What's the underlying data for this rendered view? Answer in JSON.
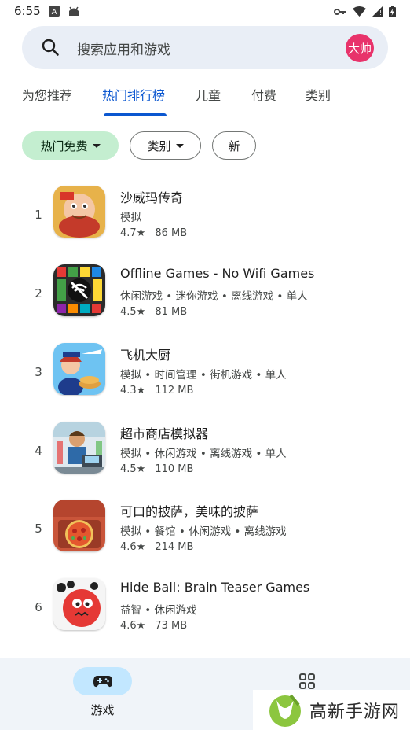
{
  "status_bar": {
    "time": "6:55",
    "left_icons": [
      "font-a-icon",
      "android-icon"
    ],
    "right_icons": [
      "key-icon",
      "wifi-icon",
      "signal-icon",
      "battery-charging-icon"
    ]
  },
  "search": {
    "placeholder": "搜索应用和游戏",
    "avatar_text": "大帅",
    "avatar_color": "#e8336b"
  },
  "tabs": [
    {
      "label": "为您推荐",
      "active": false
    },
    {
      "label": "热门排行榜",
      "active": true
    },
    {
      "label": "儿童",
      "active": false
    },
    {
      "label": "付费",
      "active": false
    },
    {
      "label": "类别",
      "active": false
    }
  ],
  "chips": [
    {
      "label": "热门免费",
      "selected": true,
      "dropdown": true
    },
    {
      "label": "类别",
      "selected": false,
      "dropdown": true
    },
    {
      "label": "新",
      "selected": false,
      "dropdown": false
    }
  ],
  "apps": [
    {
      "rank": "1",
      "name": "沙威玛传奇",
      "categories": "模拟",
      "rating": "4.7★",
      "size": "86 MB"
    },
    {
      "rank": "2",
      "name": "Offline Games - No Wifi Games",
      "categories": "休闲游戏 • 迷你游戏 • 离线游戏 • 单人",
      "rating": "4.5★",
      "size": "81 MB"
    },
    {
      "rank": "3",
      "name": "飞机大厨",
      "categories": "模拟 • 时间管理 • 街机游戏 • 单人",
      "rating": "4.3★",
      "size": "112 MB"
    },
    {
      "rank": "4",
      "name": "超市商店模拟器",
      "categories": "模拟 • 休闲游戏 • 离线游戏 • 单人",
      "rating": "4.5★",
      "size": "110 MB"
    },
    {
      "rank": "5",
      "name": "可口的披萨，美味的披萨",
      "categories": "模拟 • 餐馆 • 休闲游戏 • 离线游戏",
      "rating": "4.6★",
      "size": "214 MB"
    },
    {
      "rank": "6",
      "name": "Hide Ball: Brain Teaser Games",
      "categories": "益智 • 休闲游戏",
      "rating": "4.6★",
      "size": "73 MB"
    }
  ],
  "bottom_nav": {
    "games_label": "游戏",
    "games_icon": "gamepad-icon",
    "apps_icon": "apps-grid-icon"
  },
  "watermark": {
    "text": "高新手游网"
  },
  "colors": {
    "accent": "#0b57d0",
    "chip_selected": "#c4eed0",
    "search_bg": "#e9eef6",
    "nav_bg": "#f0f4f9",
    "nav_pill": "#c2e7ff"
  }
}
